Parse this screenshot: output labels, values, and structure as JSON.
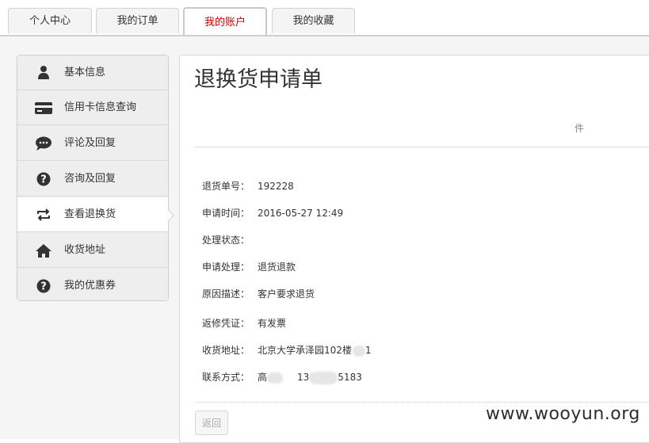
{
  "tabs": [
    {
      "label": "个人中心"
    },
    {
      "label": "我的订单"
    },
    {
      "label": "我的账户"
    },
    {
      "label": "我的收藏"
    }
  ],
  "sidebar": {
    "items": [
      {
        "label": "基本信息",
        "icon": "user-icon"
      },
      {
        "label": "信用卡信息查询",
        "icon": "credit-card-icon"
      },
      {
        "label": "评论及回复",
        "icon": "comment-icon"
      },
      {
        "label": "咨询及回复",
        "icon": "question-icon"
      },
      {
        "label": "查看退换货",
        "icon": "exchange-icon"
      },
      {
        "label": "收货地址",
        "icon": "home-icon"
      },
      {
        "label": "我的优惠券",
        "icon": "question-icon"
      }
    ]
  },
  "main": {
    "title": "退换货申请单",
    "suffix": "件",
    "fields": {
      "return_no": {
        "label": "退货单号：",
        "value": "192228"
      },
      "apply_time": {
        "label": "申请时间：",
        "value": "2016-05-27 12:49"
      },
      "status": {
        "label": "处理状态：",
        "value": ""
      },
      "apply_action": {
        "label": "申请处理：",
        "value": "退货退款"
      },
      "reason": {
        "label": "原因描述：",
        "value": "客户要求退货"
      },
      "voucher": {
        "label": "返修凭证：",
        "value": "有发票"
      },
      "address": {
        "label": "收货地址：",
        "value": "北京大学承泽园102楼",
        "value_tail": "1"
      },
      "contact": {
        "label": "联系方式：",
        "name_prefix": "高",
        "phone_prefix": "13",
        "phone_suffix": "5183"
      }
    },
    "back_button": "返回"
  },
  "watermark": "www.wooyun.org",
  "colors": {
    "active_tab": "#cc0000",
    "panel_bg": "#f5f5f5"
  }
}
